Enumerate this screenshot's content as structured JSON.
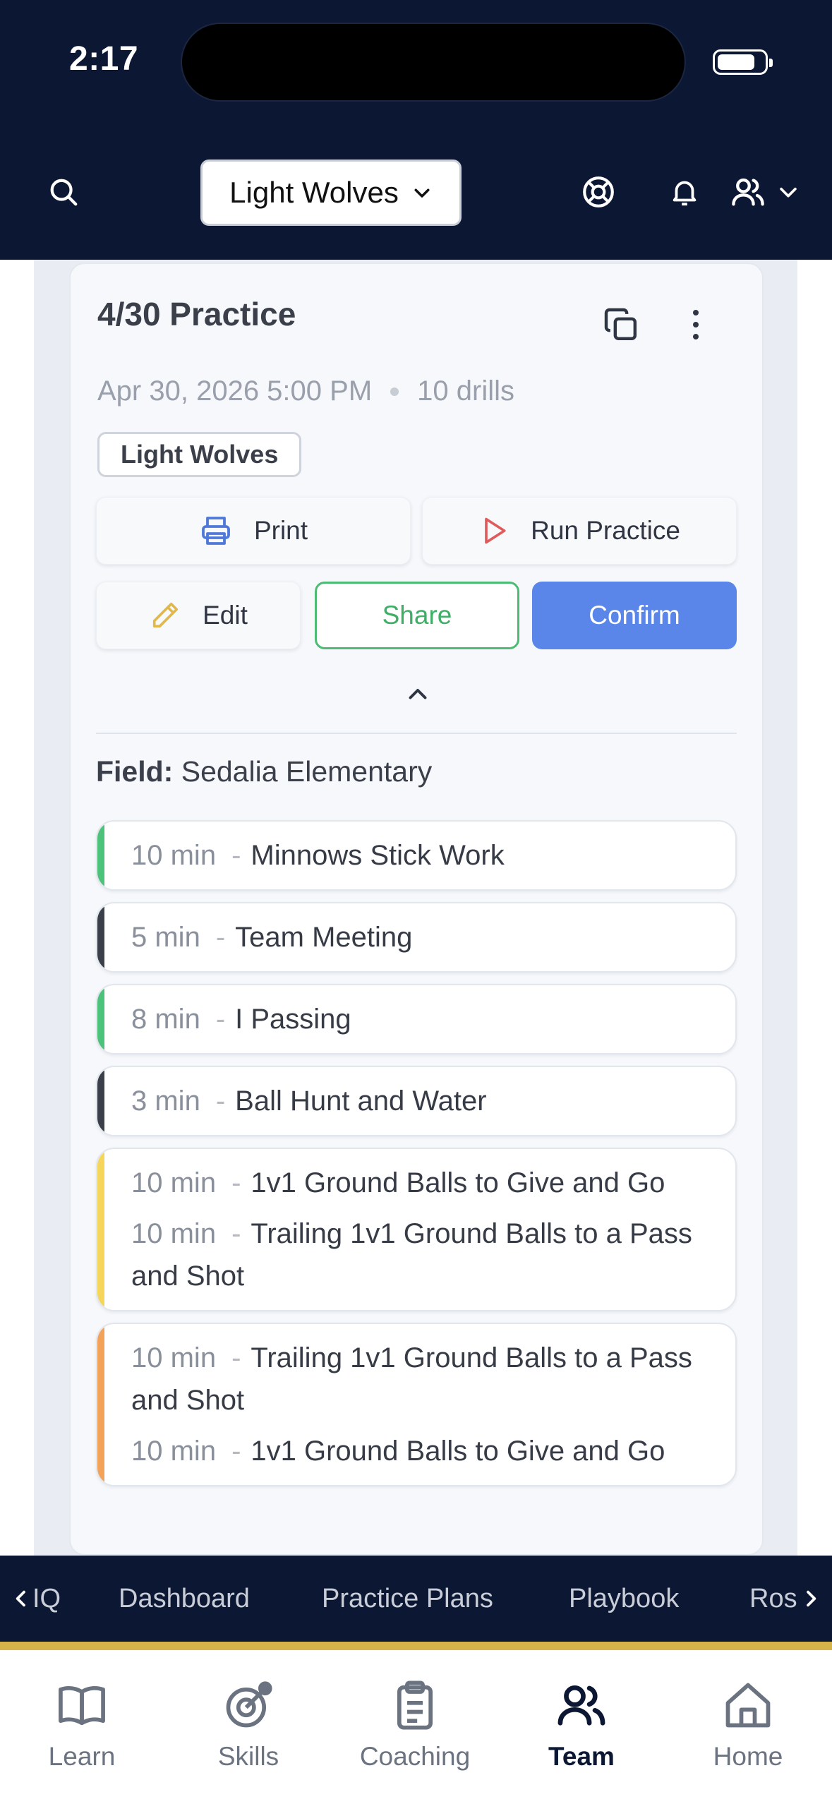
{
  "status_bar": {
    "time": "2:17"
  },
  "header": {
    "team_selector": "Light Wolves"
  },
  "practice": {
    "title": "4/30 Practice",
    "date_time": "Apr 30, 2026 5:00 PM",
    "drill_count": "10 drills",
    "team_tag": "Light Wolves",
    "buttons": {
      "print": "Print",
      "run": "Run Practice",
      "edit": "Edit",
      "share": "Share",
      "confirm": "Confirm"
    },
    "field_label": "Field:",
    "field_value": "Sedalia Elementary",
    "drill_groups": [
      {
        "accent": "#4cc27a",
        "items": [
          {
            "duration": "10 min",
            "name": "Minnows Stick Work"
          }
        ]
      },
      {
        "accent": "#3a3f4a",
        "items": [
          {
            "duration": "5 min",
            "name": "Team Meeting"
          }
        ]
      },
      {
        "accent": "#4cc27a",
        "items": [
          {
            "duration": "8 min",
            "name": "I Passing"
          }
        ]
      },
      {
        "accent": "#3a3f4a",
        "items": [
          {
            "duration": "3 min",
            "name": "Ball Hunt and Water"
          }
        ]
      },
      {
        "accent": "#f5d65a",
        "items": [
          {
            "duration": "10 min",
            "name": "1v1 Ground Balls to Give and Go"
          },
          {
            "duration": "10 min",
            "name": "Trailing 1v1 Ground Balls to a Pass and Shot"
          }
        ]
      },
      {
        "accent": "#f3a25a",
        "items": [
          {
            "duration": "10 min",
            "name": "Trailing 1v1 Ground Balls to a Pass and Shot"
          },
          {
            "duration": "10 min",
            "name": "1v1 Ground Balls to Give and Go"
          }
        ]
      }
    ]
  },
  "section_nav": {
    "items": [
      "IQ",
      "Dashboard",
      "Practice Plans",
      "Playbook",
      "Ros"
    ]
  },
  "tabbar": {
    "learn": "Learn",
    "skills": "Skills",
    "coaching": "Coaching",
    "team": "Team",
    "home": "Home",
    "active": "Team"
  },
  "icons": {
    "search": "search-icon",
    "chevron": "chevron-down-icon",
    "help": "lifebuoy-icon",
    "bell": "bell-icon",
    "user": "users-icon",
    "copy": "copy-icon",
    "more": "more-vertical-icon",
    "print": "printer-icon",
    "run": "play-icon",
    "edit": "pencil-icon"
  },
  "colors": {
    "header_bg": "#0b1733",
    "confirm": "#5a86ea",
    "share": "#4dbb73",
    "gold": "#d4b44a"
  }
}
